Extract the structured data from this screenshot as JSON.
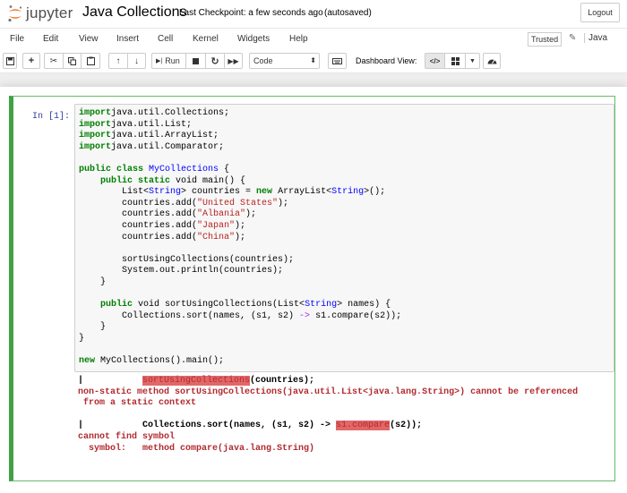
{
  "header": {
    "logo_text": "jupyter",
    "notebook_title": "Java Collections",
    "checkpoint": "Last Checkpoint: a few seconds ago",
    "autosave": "(autosaved)",
    "logout_label": "Logout"
  },
  "menubar": {
    "items": [
      "File",
      "Edit",
      "View",
      "Insert",
      "Cell",
      "Kernel",
      "Widgets",
      "Help"
    ],
    "trusted_label": "Trusted",
    "kernel_name": "Java"
  },
  "toolbar": {
    "run_label": "Run",
    "cell_type": "Code",
    "dashboard_label": "Dashboard View:"
  },
  "cell": {
    "prompt": "In [1]:",
    "code": [
      [
        [
          "kw",
          "import"
        ],
        [
          "",
          "java.util.Collections;"
        ]
      ],
      [
        [
          "kw",
          "import"
        ],
        [
          "",
          "java.util.List;"
        ]
      ],
      [
        [
          "kw",
          "import"
        ],
        [
          "",
          "java.util.ArrayList;"
        ]
      ],
      [
        [
          "kw",
          "import"
        ],
        [
          "",
          "java.util.Comparator;"
        ]
      ],
      [],
      [
        [
          "kw",
          "public class "
        ],
        [
          "ty",
          "MyCollections"
        ],
        [
          "",
          " {"
        ]
      ],
      [
        [
          "",
          "    "
        ],
        [
          "kw",
          "public static"
        ],
        [
          "",
          " void main() {"
        ]
      ],
      [
        [
          "",
          "        List<"
        ],
        [
          "ty",
          "String"
        ],
        [
          "",
          "> countries = "
        ],
        [
          "kw",
          "new"
        ],
        [
          "",
          " ArrayList<"
        ],
        [
          "ty",
          "String"
        ],
        [
          "",
          ">();"
        ]
      ],
      [
        [
          "",
          "        countries.add("
        ],
        [
          "st",
          "\"United States\""
        ],
        [
          "",
          ");"
        ]
      ],
      [
        [
          "",
          "        countries.add("
        ],
        [
          "st",
          "\"Albania\""
        ],
        [
          "",
          ");"
        ]
      ],
      [
        [
          "",
          "        countries.add("
        ],
        [
          "st",
          "\"Japan\""
        ],
        [
          "",
          ");"
        ]
      ],
      [
        [
          "",
          "        countries.add("
        ],
        [
          "st",
          "\"China\""
        ],
        [
          "",
          ");"
        ]
      ],
      [],
      [
        [
          "",
          "        sortUsingCollections(countries);"
        ]
      ],
      [
        [
          "",
          "        System.out.println(countries);"
        ]
      ],
      [
        [
          "",
          "    }"
        ]
      ],
      [],
      [
        [
          "",
          "    "
        ],
        [
          "kw",
          "public"
        ],
        [
          "",
          " void sortUsingCollections(List<"
        ],
        [
          "ty",
          "String"
        ],
        [
          "",
          "> names) {"
        ]
      ],
      [
        [
          "",
          "        Collections.sort(names, (s1, s2) "
        ],
        [
          "op",
          "->"
        ],
        [
          "",
          " s1.compare(s2));"
        ]
      ],
      [
        [
          "",
          "    }"
        ]
      ],
      [
        [
          "",
          "}"
        ]
      ],
      [],
      [
        [
          "kw",
          "new"
        ],
        [
          "",
          " MyCollections().main();"
        ]
      ]
    ],
    "output": [
      [
        [
          "blk",
          "|           "
        ],
        [
          "hl",
          "sortUsingCollections"
        ],
        [
          "blk",
          "(countries);"
        ]
      ],
      [
        [
          "err",
          "non-static method sortUsingCollections(java.util.List<java.lang.String>) cannot be referenced"
        ]
      ],
      [
        [
          "err",
          " from a static context"
        ]
      ],
      [],
      [
        [
          "blk",
          "|           Collections.sort(names, (s1, s2) -> "
        ],
        [
          "hl",
          "s1.compare"
        ],
        [
          "blk",
          "(s2));"
        ]
      ],
      [
        [
          "err",
          "cannot find symbol"
        ]
      ],
      [
        [
          "err",
          "  symbol:   method compare(java.lang.String)"
        ]
      ]
    ]
  }
}
